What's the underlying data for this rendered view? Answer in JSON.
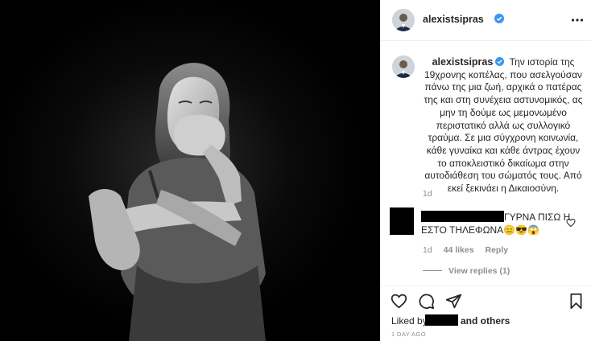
{
  "post": {
    "image_alt": "Black and white photo of a young woman covering her mouth with both hands, arms crossed over her body",
    "header": {
      "username": "alexistsipras",
      "avatar_icon": "profile-avatar",
      "verified_icon": "verified-badge-icon",
      "more_icon": "more-options-icon"
    },
    "caption": {
      "username": "alexistsipras",
      "text": "Την ιστορία της 19χρονης κοπέλας, που ασελγούσαν πάνω της μια ζωή, αρχικά ο πατέρας της και στη συνέχεια αστυνομικός, ας μην τη δούμε ως μεμονωμένο περιστατικό αλλά ως συλλογικό τραύμα. Σε μια σύγχρονη κοινωνία, κάθε γυναίκα και κάθε άντρας έχουν το αποκλειστικό δικαίωμα στην αυτοδιάθεση του σώματός τους. Από εκεί ξεκινάει η Δικαιοσύνη.",
      "time": "1d"
    },
    "comment": {
      "text_line1": "ΓΥΡΝΑ ΠΙΣΩ Η",
      "text_line2": "ΕΣΤΟ ΤΗΛΕΦΩΝΑ😑😎😱",
      "time": "1d",
      "likes": "44 likes",
      "reply": "Reply",
      "view_replies": "View replies (1)"
    },
    "actions": {
      "liked_by_prefix": "Liked by",
      "liked_by_suffix": "and others",
      "date": "1 DAY AGO"
    }
  },
  "colors": {
    "text_primary": "#262626",
    "text_secondary": "#8e8e8e",
    "verified_blue": "#3897f0",
    "divider": "#efefef"
  }
}
